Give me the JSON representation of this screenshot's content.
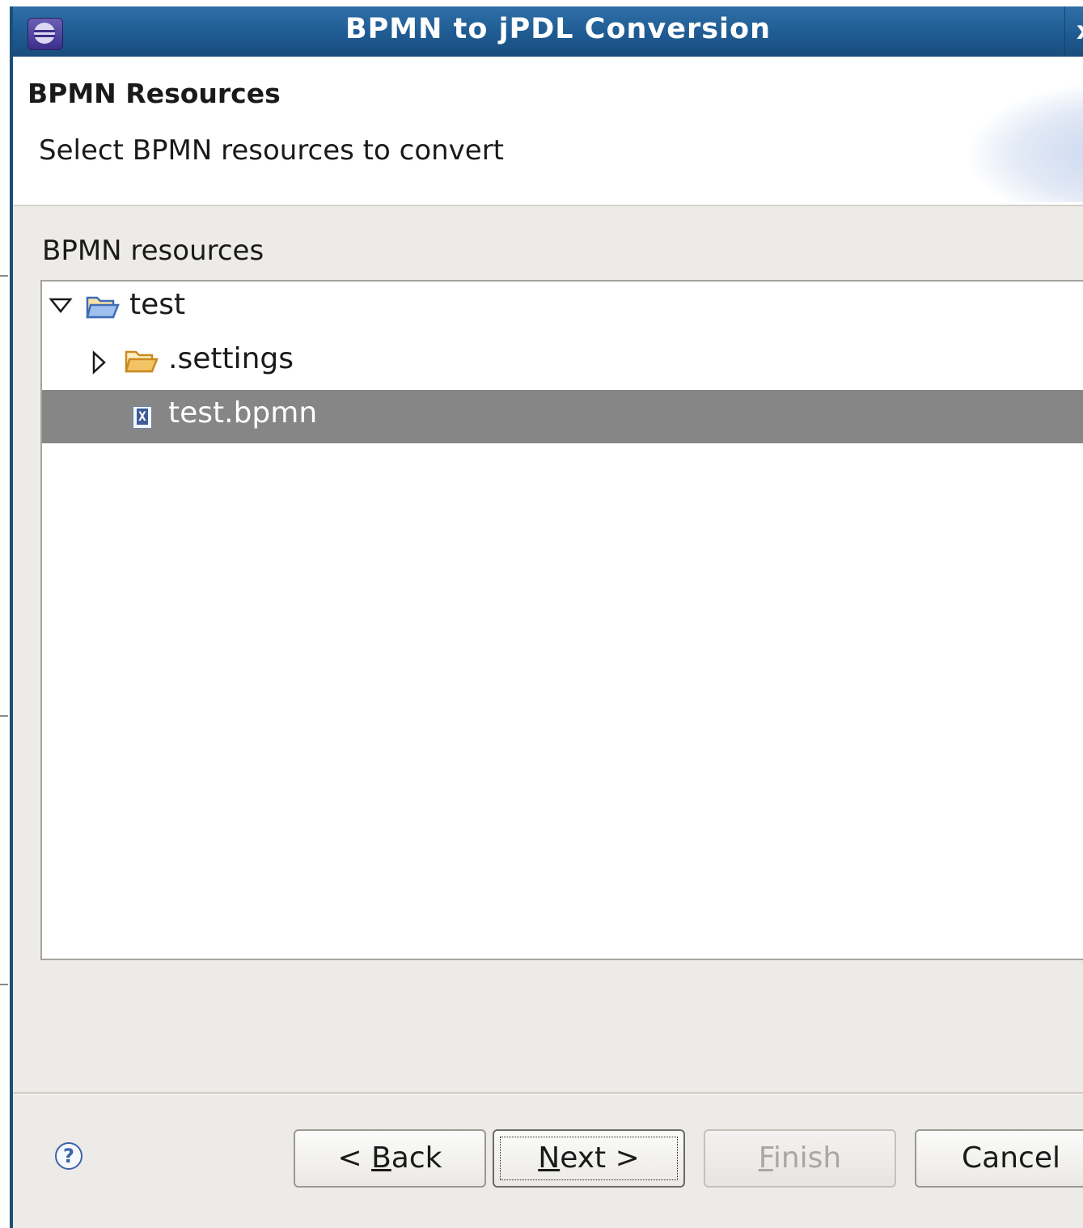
{
  "window": {
    "title": "BPMN to jPDL Conversion",
    "close_label": "x"
  },
  "header": {
    "page_title": "BPMN Resources",
    "description": "Select BPMN resources to convert"
  },
  "resources": {
    "label": "BPMN resources",
    "tree": [
      {
        "label": "test",
        "icon": "folder-open-icon",
        "expanded": true,
        "depth": 0
      },
      {
        "label": ".settings",
        "icon": "folder-icon",
        "expanded": false,
        "depth": 1
      },
      {
        "label": "test.bpmn",
        "icon": "xml-file-icon",
        "selected": true,
        "depth": 1
      }
    ]
  },
  "buttons": {
    "help_icon": "?",
    "back": {
      "prefix": "< ",
      "mnemonic": "B",
      "rest": "ack"
    },
    "next": {
      "mnemonic": "N",
      "rest": "ext >"
    },
    "finish": {
      "mnemonic": "F",
      "rest": "inish",
      "enabled": false
    },
    "cancel": "Cancel"
  },
  "colors": {
    "titlebar": "#1f5b92",
    "dialog_bg": "#edebe7",
    "selection": "#868686"
  }
}
